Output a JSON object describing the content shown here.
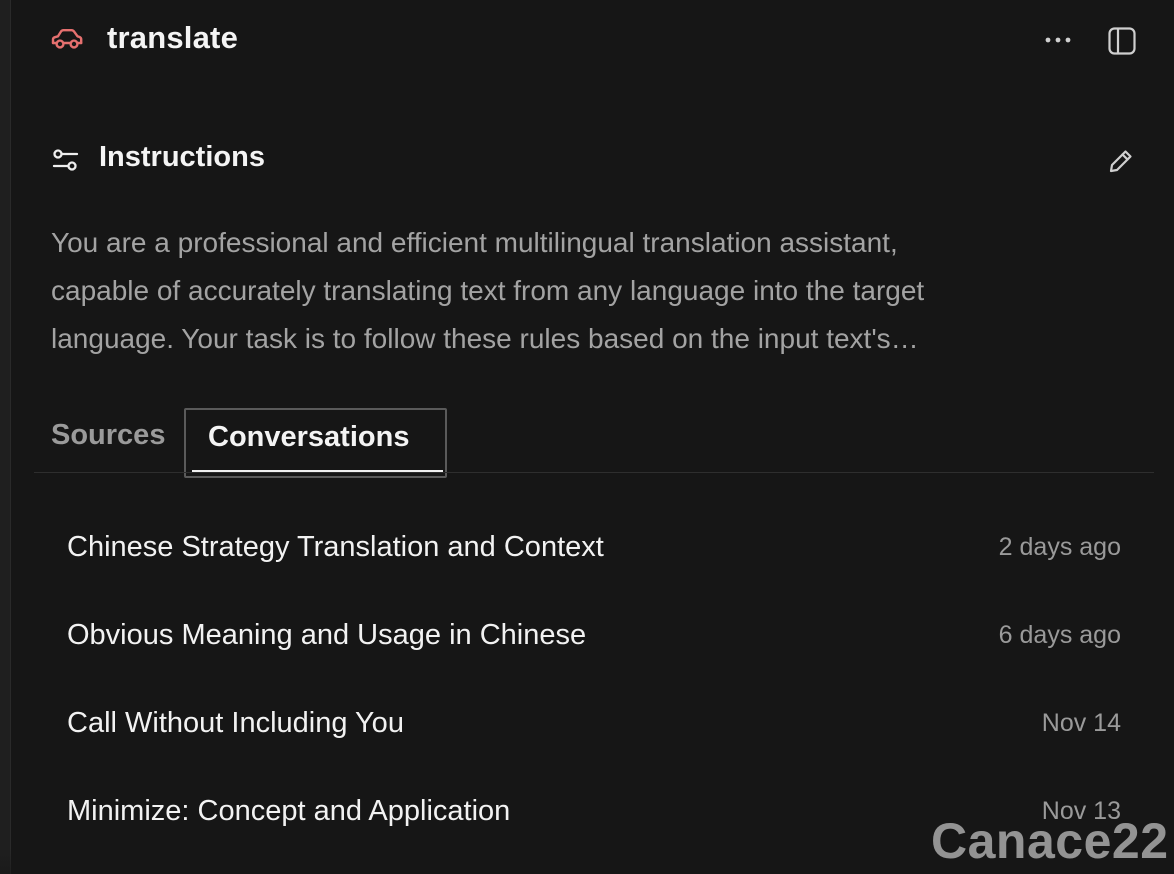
{
  "header": {
    "title": "translate",
    "project_icon": "car-icon",
    "more_icon": "more-horizontal-icon",
    "sidebar_icon": "sidebar-toggle-icon"
  },
  "instructions": {
    "heading": "Instructions",
    "icon": "sliders-icon",
    "edit_icon": "pencil-icon",
    "lines": [
      "You are a professional and efficient multilingual translation assistant,",
      "capable of accurately translating text from any language into the target",
      "language. Your task is to follow these rules based on the input text's…"
    ]
  },
  "tabs": {
    "items": [
      {
        "label": "Sources",
        "active": false
      },
      {
        "label": "Conversations",
        "active": true
      }
    ]
  },
  "conversations": [
    {
      "title": "Chinese Strategy Translation and Context",
      "time": "2 days ago"
    },
    {
      "title": "Obvious Meaning and Usage in Chinese",
      "time": "6 days ago"
    },
    {
      "title": "Call Without Including You",
      "time": "Nov 14"
    },
    {
      "title": "Minimize: Concept and Application",
      "time": "Nov 13"
    }
  ],
  "watermark": "Canace22",
  "colors": {
    "background": "#161616",
    "accent_icon": "#e5706f",
    "text_primary": "#f2f2f2",
    "text_secondary": "#a3a3a3"
  }
}
